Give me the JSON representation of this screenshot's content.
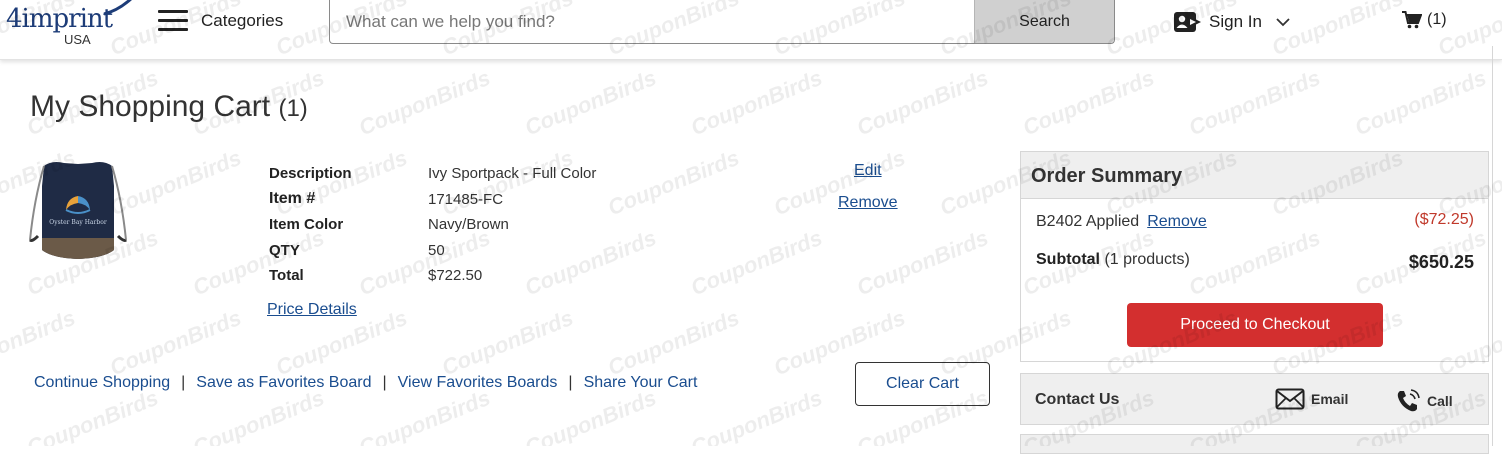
{
  "header": {
    "logo_text": "4imprint",
    "logo_sub": "USA",
    "categories_label": "Categories",
    "search_placeholder": "What can we help you find?",
    "search_button": "Search",
    "signin_label": "Sign In",
    "cart_count": "(1)"
  },
  "page": {
    "title": "My Shopping Cart",
    "title_count": "(1)"
  },
  "item": {
    "image_text": "Oyster Bay Harbor",
    "details": [
      {
        "label": "Description",
        "value": "Ivy Sportpack - Full Color"
      },
      {
        "label": "Item #",
        "value": "171485-FC"
      },
      {
        "label": "Item Color",
        "value": "Navy/Brown"
      },
      {
        "label": "QTY",
        "value": "50"
      },
      {
        "label": "Total",
        "value": "$722.50"
      }
    ],
    "price_details_label": "Price Details",
    "edit_label": "Edit",
    "remove_label": "Remove"
  },
  "bottom_links": {
    "continue": "Continue Shopping",
    "sep": "|",
    "save_board": "Save as Favorites Board",
    "view_boards": "View Favorites Boards",
    "share": "Share Your Cart",
    "clear_cart": "Clear Cart"
  },
  "summary": {
    "title": "Order Summary",
    "promo_code": "B2402 Applied",
    "promo_remove": "Remove",
    "discount": "($72.25)",
    "subtotal_label": "Subtotal",
    "subtotal_note": "(1 products)",
    "subtotal_amount": "$650.25",
    "checkout_button": "Proceed to Checkout"
  },
  "contact": {
    "title": "Contact Us",
    "email_label": "Email",
    "call_label": "Call"
  },
  "watermark": {
    "text": "CouponBirds"
  },
  "colors": {
    "link": "#1a4d8f",
    "checkout": "#d32f2f",
    "discount": "#c0392b",
    "panel_bg": "#efefef"
  }
}
